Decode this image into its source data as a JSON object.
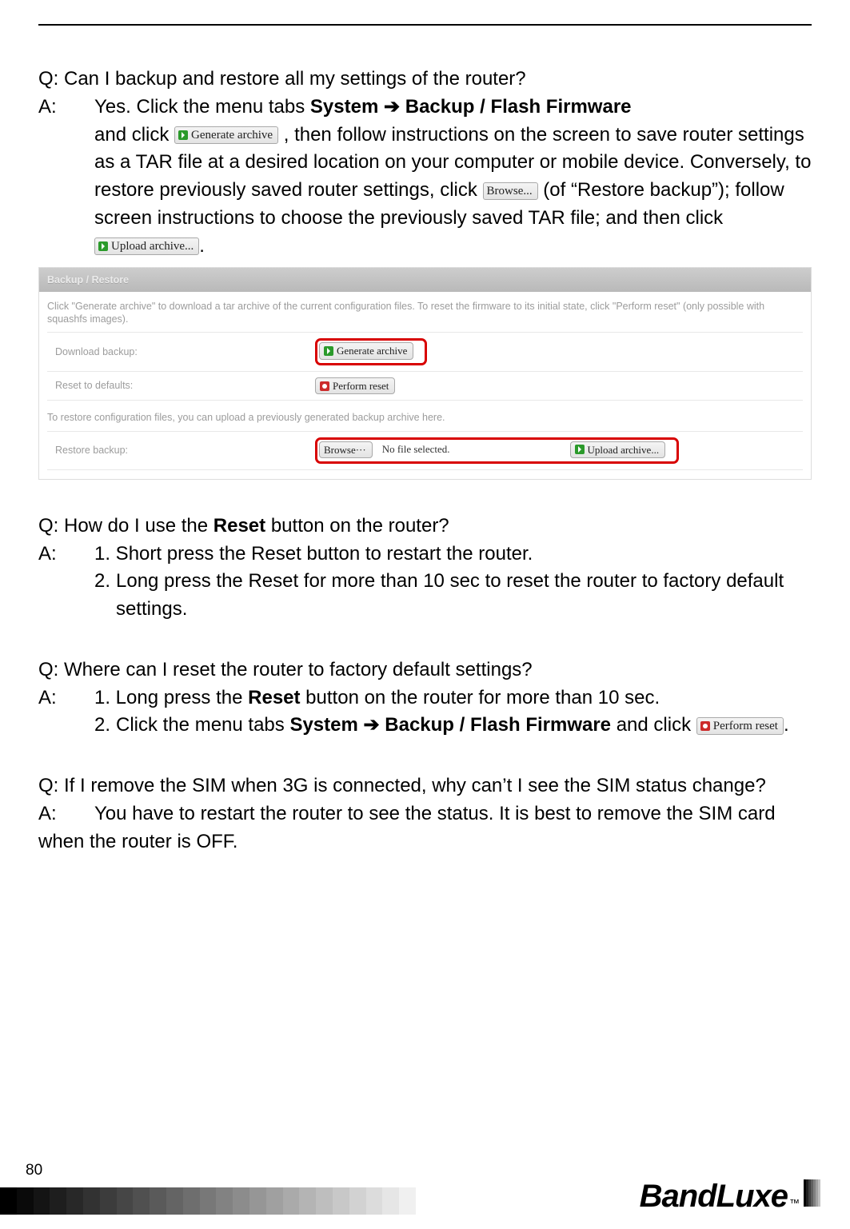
{
  "page_number": "80",
  "brand": "BandLuxe",
  "brand_tm": "™",
  "buttons": {
    "generate_archive": "Generate archive",
    "browse": "Browse...",
    "browse_ellipsis": "Browse···",
    "upload_archive": "Upload archive...",
    "perform_reset": "Perform reset"
  },
  "qa1": {
    "q": "Q: Can I backup and restore all my settings of the router?",
    "a_prefix": "A:",
    "l1_a": "Yes. Click the menu tabs ",
    "l1_b": "System ➔ Backup / Flash Firmware",
    "l2_a": "and click ",
    "l2_b": ", then follow instructions on the screen to save router settings as a TAR file at a desired location on your computer or mobile device. Conversely, to restore previously saved router settings, click ",
    "l2_c": " (of “Restore backup”); follow screen instructions to choose the previously saved TAR file; and then click ",
    "l2_d": "."
  },
  "panel": {
    "title": "Backup / Restore",
    "desc": "Click \"Generate archive\" to download a tar archive of the current configuration files. To reset the firmware to its initial state, click \"Perform reset\" (only possible with squashfs images).",
    "row1_label": "Download backup:",
    "row2_label": "Reset to defaults:",
    "desc2": "To restore configuration files, you can upload a previously generated backup archive here.",
    "row3_label": "Restore backup:",
    "no_file": "No file selected."
  },
  "qa2": {
    "q_pre": "Q: How do I use the ",
    "q_bold": "Reset",
    "q_post": " button on the router?",
    "a_prefix": "A:",
    "a1": "1. Short press the Reset button to restart the router.",
    "a2": "2. Long press the Reset for more than 10 sec to reset the router to factory default settings."
  },
  "qa3": {
    "q": "Q: Where can I reset the router to factory default settings?",
    "a_prefix": "A:",
    "a1_a": "1. Long press the ",
    "a1_b": "Reset",
    "a1_c": " button on the router for more than 10 sec.",
    "a2_a": "2. Click the menu tabs ",
    "a2_b": "System ➔ Backup / Flash Firmware",
    "a2_c": " and click ",
    "a2_d": "."
  },
  "qa4": {
    "q": "Q: If I remove the SIM when 3G is connected, why can’t I see the SIM status change?",
    "a_prefix": "A:",
    "a": "You have to restart the router to see the status. It is best to remove the SIM card when the router is OFF."
  }
}
